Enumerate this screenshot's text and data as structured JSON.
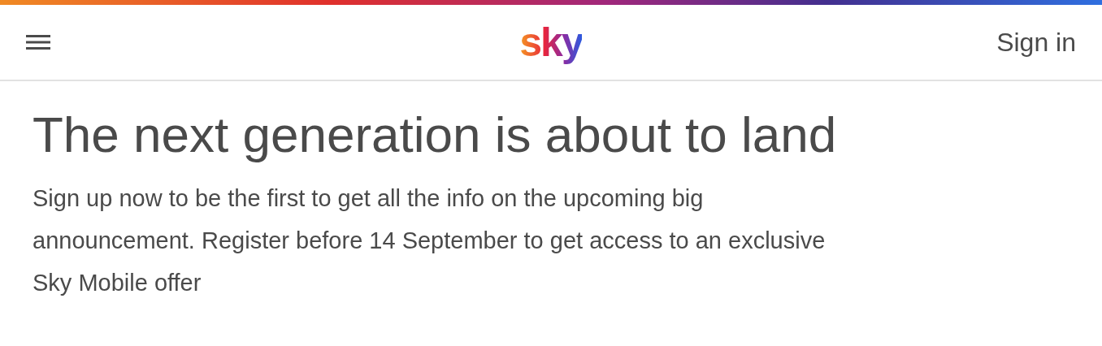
{
  "header": {
    "logo": "sky",
    "sign_in": "Sign in"
  },
  "headline": "The next generation is about to land",
  "body": "Sign up now to be the first to get all the info on the upcoming big announcement. Register before 14 September to get access to an exclusive Sky Mobile offer"
}
